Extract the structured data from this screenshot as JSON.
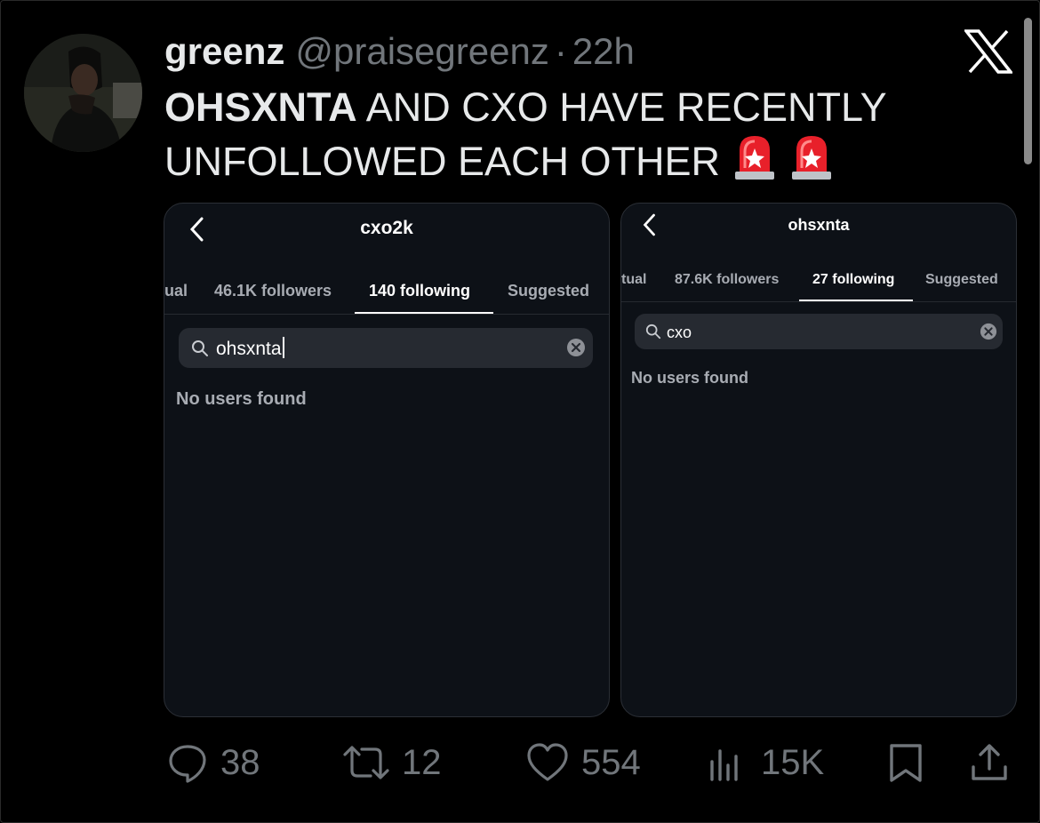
{
  "tweet": {
    "display_name": "greenz",
    "handle": "@praisegreenz",
    "separator": "·",
    "time": "22h",
    "text_bold": "OHSXNTA",
    "text_rest": " AND CXO HAVE RECENTLY UNFOLLOWED EACH OTHER",
    "emoji_icons": [
      "police-car-light-icon",
      "police-car-light-icon"
    ]
  },
  "screenshots": [
    {
      "title": "cxo2k",
      "tabs": [
        "ual",
        "46.1K followers",
        "140 following",
        "Suggested"
      ],
      "active_tab": "140 following",
      "search_value": "ohsxnta",
      "empty_message": "No users found"
    },
    {
      "title": "ohsxnta",
      "tabs": [
        "tual",
        "87.6K followers",
        "27 following",
        "Suggested"
      ],
      "active_tab": "27 following",
      "search_value": "cxo",
      "empty_message": "No users found"
    }
  ],
  "actions": {
    "replies": "38",
    "reposts": "12",
    "likes": "554",
    "views": "15K"
  },
  "colors": {
    "background": "#000000",
    "text": "#e7e9ea",
    "muted": "#71767b",
    "card": "#0d1117",
    "siren_red": "#e8202a"
  }
}
